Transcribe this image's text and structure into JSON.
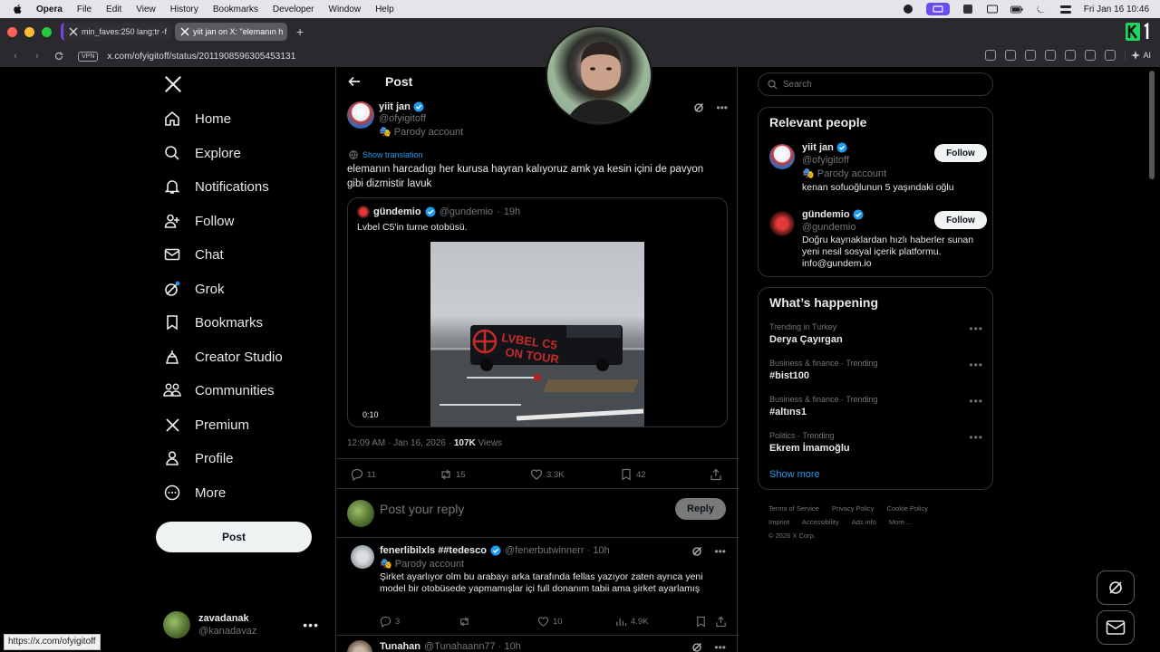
{
  "menubar": {
    "app": "Opera",
    "items": [
      "File",
      "Edit",
      "View",
      "History",
      "Bookmarks",
      "Developer",
      "Window",
      "Help"
    ],
    "datetime": "Fri Jan 16  10:46"
  },
  "tabs": [
    {
      "label": "min_faves:250 lang:tr -f"
    },
    {
      "label": "yiit jan on X: \"elemanın h"
    }
  ],
  "address": {
    "vpn": "VPN",
    "url": "x.com/ofyigitoff/status/2011908596305453131",
    "ai": "AI"
  },
  "nav": {
    "items": [
      {
        "label": "Home",
        "icon": "home-icon"
      },
      {
        "label": "Explore",
        "icon": "search-icon"
      },
      {
        "label": "Notifications",
        "icon": "bell-icon"
      },
      {
        "label": "Follow",
        "icon": "add-person-icon"
      },
      {
        "label": "Chat",
        "icon": "mail-icon"
      },
      {
        "label": "Grok",
        "icon": "grok-icon"
      },
      {
        "label": "Bookmarks",
        "icon": "bookmark-icon"
      },
      {
        "label": "Creator Studio",
        "icon": "creator-icon"
      },
      {
        "label": "Communities",
        "icon": "communities-icon"
      },
      {
        "label": "Premium",
        "icon": "x-icon"
      },
      {
        "label": "Profile",
        "icon": "person-icon"
      },
      {
        "label": "More",
        "icon": "more-circle-icon"
      }
    ],
    "post_button": "Post",
    "account": {
      "name": "zavadanak",
      "handle": "@kanadavaz"
    }
  },
  "post": {
    "header": "Post",
    "author": {
      "name": "yiit jan",
      "handle": "@ofyigitoff",
      "badge": "Parody account"
    },
    "show_translation": "Show translation",
    "text": "elemanın harcadıgı her kurusa hayran kalıyoruz amk ya kesin içini de pavyon gibi dizmistir lavuk",
    "quote": {
      "name": "gündemio",
      "handle": "@gundemio",
      "time": "19h",
      "text": "Lvbel C5'in turne otobüsü.",
      "video_time": "0:10",
      "bus_text_1": "LVBEL C5",
      "bus_text_2": "ON TOUR"
    },
    "timestamp": "12:09 AM · Jan 16, 2026 · ",
    "views_count": "107K",
    "views_label": " Views",
    "actions": {
      "replies": "11",
      "reposts": "15",
      "likes": "3.3K",
      "bookmarks": "42"
    },
    "reply_placeholder": "Post your reply",
    "reply_button": "Reply"
  },
  "replies": [
    {
      "name": "fenerlibilxls ##tedesco",
      "handle": "@fenerbutwinnerr · 10h",
      "badge": "Parody account",
      "text": "Şirket ayarlıyor olm bu arabayı arka tarafında fellas yazıyor zaten ayrıca yeni model bir otobüsede yapmamışlar içi full donanım tabii ama şirket ayarlamış",
      "replies": "3",
      "reposts": "",
      "likes": "10",
      "views": "4.9K"
    },
    {
      "name": "Tunahan",
      "handle": "@Tunahaann77 · 10h"
    }
  ],
  "right": {
    "search_placeholder": "Search",
    "relevant_title": "Relevant people",
    "people": [
      {
        "name": "yiit jan",
        "handle": "@ofyigitoff",
        "badge": "Parody account",
        "bio": "kenan sofuoğlunun 5 yaşındaki oğlu",
        "follow": "Follow"
      },
      {
        "name": "gündemio",
        "handle": "@gundemio",
        "bio": "Doğru kaynaklardan hızlı haberler sunan yeni nesil sosyal içerik platformu. info@gundem.io",
        "follow": "Follow"
      }
    ],
    "happening_title": "What’s happening",
    "trends": [
      {
        "context": "Trending in Turkey",
        "title": "Derya Çayırgan"
      },
      {
        "context": "Business & finance · Trending",
        "title": "#bist100"
      },
      {
        "context": "Business & finance · Trending",
        "title": "#altıns1"
      },
      {
        "context": "Politics · Trending",
        "title": "Ekrem İmamoğlu"
      }
    ],
    "show_more": "Show more",
    "footer": [
      "Terms of Service",
      "Privacy Policy",
      "Cookie Policy",
      "Imprint",
      "Accessibility",
      "Ads info",
      "More ...",
      "© 2026 X Corp."
    ]
  },
  "status_url": "https://x.com/ofyigitoff",
  "colors": {
    "accent": "#1d9bf0",
    "background": "#000000",
    "border": "#2f3336",
    "muted": "#71767b"
  }
}
